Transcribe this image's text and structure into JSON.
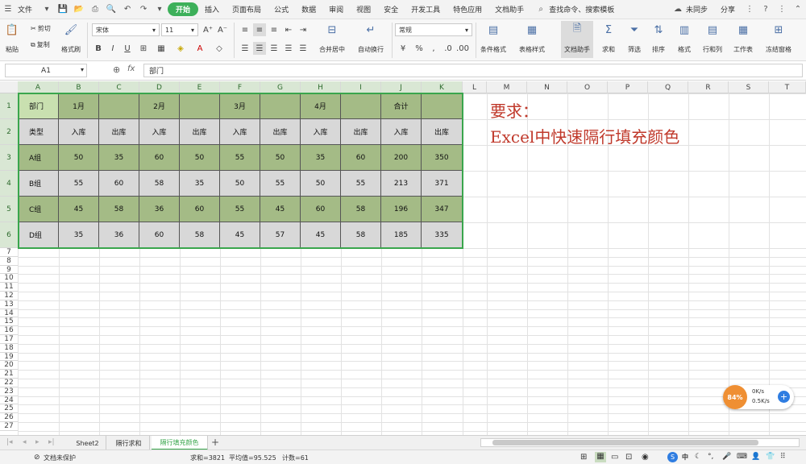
{
  "menu": {
    "file": "文件",
    "tabs": [
      "开始",
      "插入",
      "页面布局",
      "公式",
      "数据",
      "审阅",
      "视图",
      "安全",
      "开发工具",
      "特色应用",
      "文档助手"
    ],
    "active_tab": "开始",
    "search": "查找命令、搜索模板",
    "sync": "未同步",
    "share": "分享"
  },
  "ribbon": {
    "paste": "粘贴",
    "cut": "剪切",
    "copy": "复制",
    "format_painter": "格式刷",
    "font_name": "宋体",
    "font_size": "11",
    "merge_center": "合并居中",
    "wrap_text": "自动换行",
    "number_format": "常规",
    "conditional_format": "条件格式",
    "table_style": "表格样式",
    "doc_assistant": "文档助手",
    "sum": "求和",
    "filter": "筛选",
    "sort": "排序",
    "format": "格式",
    "rows_cols": "行和列",
    "worksheet": "工作表",
    "freeze": "冻结窗格"
  },
  "formula_bar": {
    "name_box": "A1",
    "fx": "fx",
    "content": "部门"
  },
  "columns": [
    "A",
    "B",
    "C",
    "D",
    "E",
    "F",
    "G",
    "H",
    "I",
    "J",
    "K",
    "L",
    "M",
    "N",
    "O",
    "P",
    "Q",
    "R",
    "S",
    "T"
  ],
  "rows": [
    "1",
    "2",
    "3",
    "4",
    "5",
    "6",
    "7",
    "8",
    "9",
    "10",
    "11",
    "12",
    "13",
    "14",
    "15",
    "16",
    "17",
    "18",
    "19",
    "20",
    "21",
    "22",
    "23",
    "24",
    "25",
    "26",
    "27"
  ],
  "table": [
    [
      "部门",
      "1月",
      "",
      "2月",
      "",
      "3月",
      "",
      "4月",
      "",
      "合计",
      ""
    ],
    [
      "类型",
      "入库",
      "出库",
      "入库",
      "出库",
      "入库",
      "出库",
      "入库",
      "出库",
      "入库",
      "出库"
    ],
    [
      "A组",
      "50",
      "35",
      "60",
      "50",
      "55",
      "50",
      "35",
      "60",
      "200",
      "350"
    ],
    [
      "B组",
      "55",
      "60",
      "58",
      "35",
      "50",
      "55",
      "50",
      "55",
      "213",
      "371"
    ],
    [
      "C组",
      "45",
      "58",
      "36",
      "60",
      "55",
      "45",
      "60",
      "58",
      "196",
      "347"
    ],
    [
      "D组",
      "35",
      "36",
      "60",
      "58",
      "45",
      "57",
      "45",
      "58",
      "185",
      "335"
    ]
  ],
  "colors": {
    "green_row": "#a4bb86",
    "gray_row": "#d8d8d8",
    "selected_cell": "#c9e0b0",
    "border_green": "#3aa64d",
    "note_red": "#c0392b",
    "accent": "#3db05a"
  },
  "note": {
    "line1": "要求：",
    "line2": "Excel中快速隔行填充颜色"
  },
  "sheets": [
    "Sheet2",
    "隔行求和",
    "隔行填充颜色"
  ],
  "active_sheet": "隔行填充颜色",
  "status": {
    "protect": "文档未保护",
    "sum": "求和=3821",
    "avg": "平均值=95.525",
    "count": "计数=61",
    "lang": "中"
  },
  "widget": {
    "percent": "84%",
    "up": "0K/s",
    "down": "0.5K/s"
  }
}
